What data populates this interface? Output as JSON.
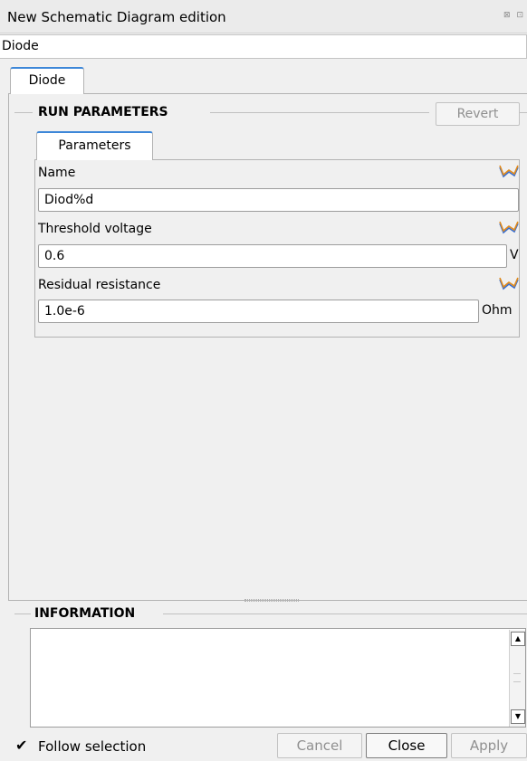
{
  "window": {
    "title": "New Schematic Diagram edition",
    "title_icons": "⊠ ⊡"
  },
  "object_name": "Diode",
  "outer_tab": {
    "label": "Diode"
  },
  "run_parameters": {
    "title": "RUN PARAMETERS",
    "revert_label": "Revert",
    "inner_tab": {
      "label": "Parameters"
    },
    "params": [
      {
        "label": "Name",
        "value": "Diod%d",
        "unit": ""
      },
      {
        "label": "Threshold voltage",
        "value": "0.6",
        "unit": "V"
      },
      {
        "label": "Residual resistance",
        "value": "1.0e-6",
        "unit": "Ohm"
      }
    ],
    "icon": "plot-curve-icon",
    "icon_colors": {
      "orange": "#e08a1c",
      "blue": "#3a6fcf"
    }
  },
  "information": {
    "title": "INFORMATION",
    "content": ""
  },
  "footer": {
    "follow_selection_label": "Follow selection",
    "follow_selection_checked": true,
    "check_glyph": "✔",
    "cancel_label": "Cancel",
    "close_label": "Close",
    "apply_label": "Apply"
  },
  "accent_color": "#3d87d8"
}
